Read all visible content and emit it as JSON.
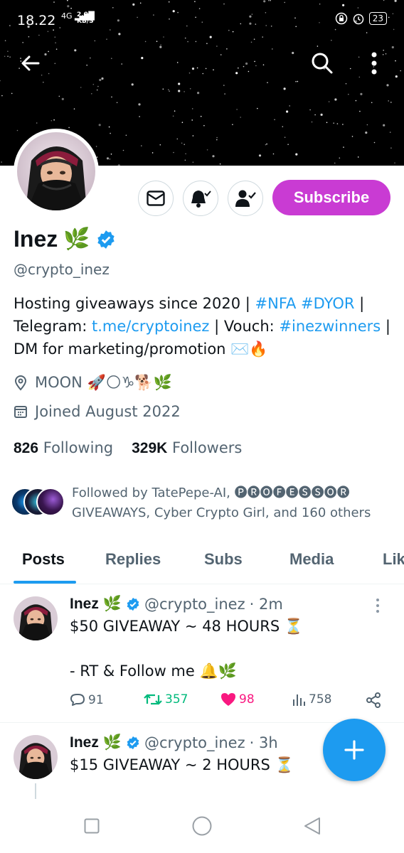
{
  "status_bar": {
    "time": "18.22",
    "network": "4G",
    "speed_value": "2.00",
    "speed_unit": "KB/S",
    "battery": "23"
  },
  "profile": {
    "name": "Inez",
    "handle": "@crypto_inez",
    "bio_part1": "Hosting giveaways since 2020 | ",
    "bio_tag1": "#NFA",
    "bio_sp": " ",
    "bio_tag2": "#DYOR",
    "bio_part2": " | Telegram: ",
    "bio_link": "t.me/cryptoinez",
    "bio_part3": " | Vouch: ",
    "bio_tag3": "#inezwinners",
    "bio_part4": " | DM for marketing/promotion  ✉️🔥",
    "location": "MOON 🚀🌕♑🐕🌿",
    "joined": "Joined August 2022",
    "following_count": "826",
    "following_label": "Following",
    "followers_count": "329K",
    "followers_label": "Followers",
    "followed_by": "Followed by TatePepe-AI, 🅟🅡🅞🅕🅔🅢🅢🅞🅡 GIVEAWAYS, Cyber Crypto Girl, and 160 others",
    "subscribe_label": "Subscribe"
  },
  "tabs": [
    {
      "label": "Posts",
      "active": true
    },
    {
      "label": "Replies",
      "active": false
    },
    {
      "label": "Subs",
      "active": false
    },
    {
      "label": "Media",
      "active": false
    },
    {
      "label": "Lik",
      "active": false
    }
  ],
  "posts": [
    {
      "name": "Inez",
      "handle": "@crypto_inez",
      "time": "· 2m",
      "line1": "$50 GIVEAWAY ~ 48 HOURS ⏳",
      "line2": "- RT & Follow me 🔔🌿",
      "replies": "91",
      "reposts": "357",
      "likes": "98",
      "views": "758"
    },
    {
      "name": "Inez",
      "handle": "@crypto_inez",
      "time": "· 3h",
      "line1": "$15 GIVEAWAY ~ 2 HOURS ⏳"
    }
  ],
  "colors": {
    "accent": "#1d9bf0",
    "subscribe": "#c93bd3",
    "repost": "#00ba7c",
    "like": "#f91880"
  }
}
